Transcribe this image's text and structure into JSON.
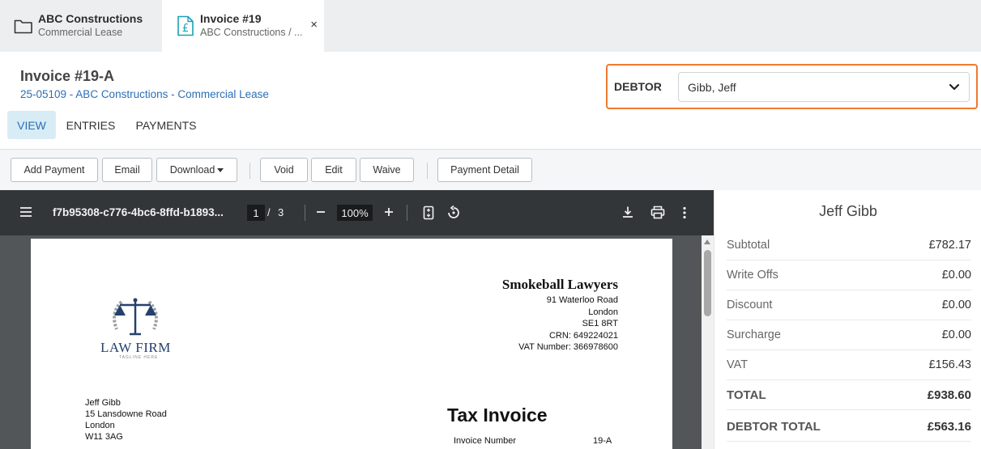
{
  "tabs": [
    {
      "title": "ABC Constructions",
      "subtitle": "Commercial Lease",
      "icon": "folder-icon"
    },
    {
      "title": "Invoice #19",
      "subtitle": "ABC Constructions / ...",
      "icon": "invoice-pound-icon",
      "close": "×"
    }
  ],
  "header": {
    "title": "Invoice #19-A",
    "matter_link": "25-05109 - ABC Constructions - Commercial Lease"
  },
  "debtor": {
    "label": "DEBTOR",
    "selected": "Gibb, Jeff",
    "accent": "#f07a30"
  },
  "view_tabs": [
    "VIEW",
    "ENTRIES",
    "PAYMENTS"
  ],
  "toolbar": {
    "add_payment": "Add Payment",
    "email": "Email",
    "download": "Download",
    "void": "Void",
    "edit": "Edit",
    "waive": "Waive",
    "payment_detail": "Payment Detail"
  },
  "pdf": {
    "filename": "f7b95308-c776-4bc6-8ffd-b1893...",
    "page": "1",
    "separator": "/",
    "total_pages": "3",
    "zoom": "100%",
    "document": {
      "logo_title": "LAW FIRM",
      "logo_tagline": "TAGLINE HERE",
      "firm_name": "Smokeball Lawyers",
      "firm_address": [
        "91 Waterloo Road",
        "London",
        "SE1 8RT",
        "CRN: 649224021",
        "VAT Number: 366978600"
      ],
      "client_address": [
        "Jeff Gibb",
        "15 Lansdowne Road",
        "London",
        "W11 3AG"
      ],
      "doc_title": "Tax Invoice",
      "invoice_number_label": "Invoice Number",
      "invoice_number_value": "19-A"
    }
  },
  "summary": {
    "name": "Jeff Gibb",
    "rows": [
      {
        "label": "Subtotal",
        "value": "£782.17"
      },
      {
        "label": "Write Offs",
        "value": "£0.00"
      },
      {
        "label": "Discount",
        "value": "£0.00"
      },
      {
        "label": "Surcharge",
        "value": "£0.00"
      },
      {
        "label": "VAT",
        "value": "£156.43"
      },
      {
        "label": "TOTAL",
        "value": "£938.60"
      },
      {
        "label": "DEBTOR TOTAL",
        "value": "£563.16"
      }
    ]
  }
}
